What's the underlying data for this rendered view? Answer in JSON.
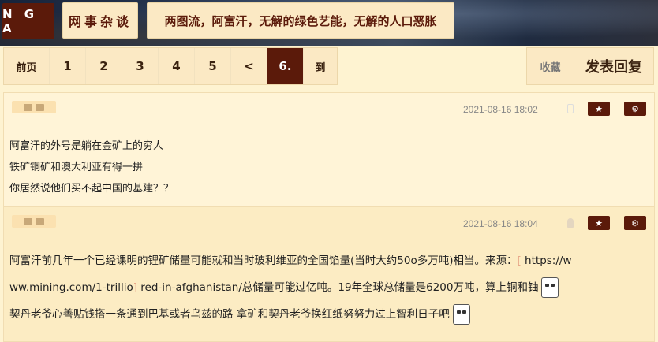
{
  "header": {
    "logo": "N G A",
    "forum": "网事杂谈",
    "thread_title": "两图流，阿富汗，无解的绿色艺能，无解的人口恶胀"
  },
  "pager": {
    "first": "前页",
    "pages": [
      "1",
      "2",
      "3",
      "4",
      "5",
      "<"
    ],
    "current": "6.",
    "goto": "到"
  },
  "actions": {
    "favorite": "收藏",
    "reply": "发表回复"
  },
  "posts": [
    {
      "date": "2021-08-16 18:02",
      "device": "phone-icon",
      "lines": [
        "阿富汗的外号是躺在金矿上的穷人",
        "铁矿铜矿和澳大利亚有得一拼",
        "你居然说他们买不起中国的基建？？"
      ]
    },
    {
      "date": "2021-08-16 18:04",
      "device": "android-icon",
      "line1_a": "阿富汗前几年一个已经课明的锂矿储量可能就和当时玻利维亚的全国馅量(当时大约50o多万吨)相当。来源：",
      "line1_bracket": "[",
      "line1_b": " https://w",
      "line2_a": "ww.mining.com/1-trillio",
      "line2_bracket": "]",
      "line2_b": " red-in-afghanistan/总储量可能过亿吨。19年全球总储量是6200万吨，算上铜和铀",
      "line3": "契丹老爷心善贴钱搭一条通到巴基或者乌兹的路 拿矿和契丹老爷换红纸努努力过上智利日子吧"
    }
  ],
  "colors": {
    "accent": "#5b1a0a",
    "background": "#fef3d1",
    "post_alt": "#fcecc3"
  }
}
